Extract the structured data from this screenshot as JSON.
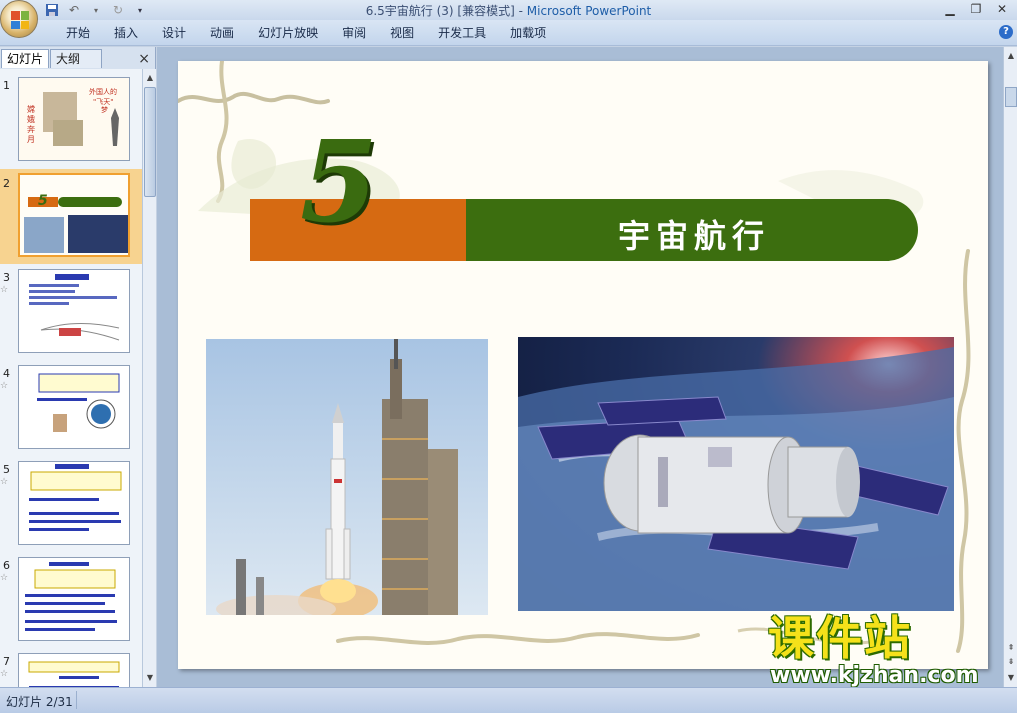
{
  "window": {
    "title_doc": "6.5宇宙航行 (3) [兼容模式]",
    "title_sep": " - ",
    "title_app": "Microsoft PowerPoint"
  },
  "ribbon_tabs": [
    "开始",
    "插入",
    "设计",
    "动画",
    "幻灯片放映",
    "审阅",
    "视图",
    "开发工具",
    "加载项"
  ],
  "left_pane": {
    "tab_slides": "幻灯片",
    "tab_outline": "大纲",
    "close": "×",
    "thumbnails": [
      {
        "num": "1",
        "selected": false
      },
      {
        "num": "2",
        "selected": true
      },
      {
        "num": "3",
        "selected": false
      },
      {
        "num": "4",
        "selected": false
      },
      {
        "num": "5",
        "selected": false
      },
      {
        "num": "6",
        "selected": false
      },
      {
        "num": "7",
        "selected": false
      }
    ]
  },
  "slide": {
    "number": "5",
    "title": "宇宙航行"
  },
  "watermark": {
    "cn": "课件站",
    "url": "www.kjzhan.com"
  },
  "status": {
    "slide_counter": "幻灯片 2/31"
  },
  "colors": {
    "orange": "#d66a12",
    "green": "#3c6e0f"
  }
}
